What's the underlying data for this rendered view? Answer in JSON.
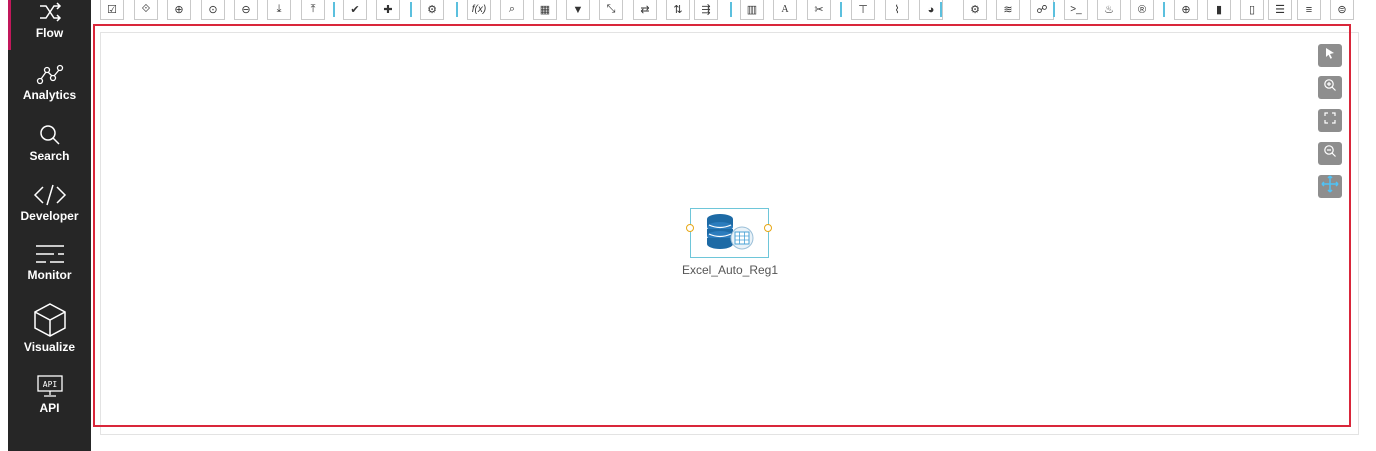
{
  "sidebar": {
    "active_color": "#c2185b",
    "items": [
      {
        "label": "Flow",
        "icon": "flow-icon",
        "active": true
      },
      {
        "label": "Analytics",
        "icon": "analytics-icon"
      },
      {
        "label": "Search",
        "icon": "search-icon"
      },
      {
        "label": "Developer",
        "icon": "code-icon"
      },
      {
        "label": "Monitor",
        "icon": "monitor-icon"
      },
      {
        "label": "Visualize",
        "icon": "cube-icon"
      },
      {
        "label": "API",
        "icon": "api-icon",
        "icon_text": "API"
      }
    ]
  },
  "toolbar": {
    "separator_color": "#5bc0de",
    "buttons": [
      {
        "icon": "check-list-icon"
      },
      {
        "icon": "eye-code-icon"
      },
      {
        "icon": "add-circle-icon"
      },
      {
        "icon": "radio-circle-icon"
      },
      {
        "icon": "remove-circle-icon"
      },
      {
        "icon": "download-icon"
      },
      {
        "icon": "upload-icon"
      },
      {
        "icon": "checkmark-icon"
      },
      {
        "icon": "plus-icon"
      },
      {
        "icon": "gears-icon"
      },
      {
        "icon": "function-icon",
        "text": "f(x)"
      },
      {
        "icon": "search-icon"
      },
      {
        "icon": "excel-icon"
      },
      {
        "icon": "filter-icon"
      },
      {
        "icon": "collapse-arrows-icon"
      },
      {
        "icon": "swap-arrows-icon"
      },
      {
        "icon": "sort-az-icon"
      },
      {
        "icon": "route-icon"
      },
      {
        "icon": "bar-chart-icon"
      },
      {
        "icon": "font-icon",
        "text": "A"
      },
      {
        "icon": "scissors-icon"
      },
      {
        "icon": "hierarchy-icon"
      },
      {
        "icon": "line-chart-icon"
      },
      {
        "icon": "pie-chart-icon"
      },
      {
        "icon": "gear-icon"
      },
      {
        "icon": "database-icon"
      },
      {
        "icon": "handshake-icon"
      },
      {
        "icon": "terminal-icon",
        "text": ">_"
      },
      {
        "icon": "java-icon"
      },
      {
        "icon": "r-language-icon"
      },
      {
        "icon": "globe-icon"
      },
      {
        "icon": "file-icon"
      },
      {
        "icon": "cylinder-icon"
      },
      {
        "icon": "indent-icon"
      },
      {
        "icon": "layers-icon"
      },
      {
        "icon": "db-stack-icon"
      }
    ]
  },
  "canvas": {
    "highlight_color": "#d9263a",
    "controls": [
      {
        "icon": "pointer-icon"
      },
      {
        "icon": "zoom-in-icon"
      },
      {
        "icon": "fit-screen-icon"
      },
      {
        "icon": "zoom-out-icon"
      },
      {
        "icon": "pan-icon"
      }
    ],
    "node": {
      "label": "Excel_Auto_Reg1",
      "icon": "excel-database-icon"
    }
  }
}
